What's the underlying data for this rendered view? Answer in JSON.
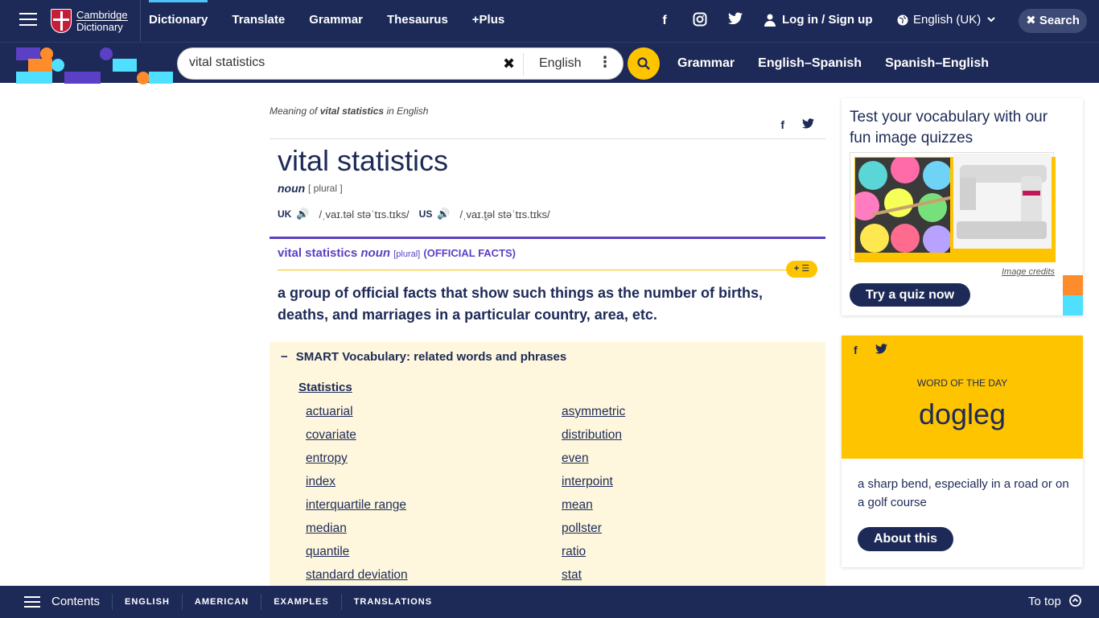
{
  "topnav": {
    "logo_line1": "Cambridge",
    "logo_line2": "Dictionary",
    "links": [
      "Dictionary",
      "Translate",
      "Grammar",
      "Thesaurus",
      "+Plus"
    ],
    "active_link": "Dictionary",
    "social": [
      "facebook-icon",
      "instagram-icon",
      "twitter-icon"
    ],
    "login": "Log in / Sign up",
    "language": "English (UK)",
    "search_label": "Search"
  },
  "subbar": {
    "search_value": "vital statistics",
    "dict_language": "English",
    "links": [
      "Grammar",
      "English–Spanish",
      "Spanish–English"
    ]
  },
  "entry": {
    "meaning_prefix": "Meaning of",
    "meaning_word": "vital statistics",
    "meaning_suffix": "in English",
    "headword": "vital statistics",
    "pos": "noun",
    "grammar": "[ plural ]",
    "uk_label": "UK",
    "uk_ipa": "/ˌvaɪ.təl stəˈtɪs.tɪks/",
    "us_label": "US",
    "us_ipa": "/ˌvaɪ.t̬əl stəˈtɪs.tɪks/",
    "sense_word": "vital statistics",
    "sense_pos": "noun",
    "sense_gram": "[plural]",
    "sense_guide": "(OFFICIAL FACTS)",
    "plus_label": "+ ☰",
    "definition": "a group of official facts that show such things as the number of births, deaths, and marriages in a particular country, area, etc."
  },
  "smart_vocab": {
    "minus": "−",
    "title": "SMART Vocabulary: related words and phrases",
    "topic": "Statistics",
    "col1": [
      "actuarial",
      "covariate",
      "entropy",
      "index",
      "interquartile range",
      "median",
      "quantile",
      "standard deviation"
    ],
    "col2": [
      "asymmetric",
      "distribution",
      "even",
      "interpoint",
      "mean",
      "pollster",
      "ratio",
      "stat"
    ]
  },
  "quiz": {
    "title": "Test your vocabulary with our fun image quizzes",
    "image_credits": "Image credits",
    "button": "Try a quiz now"
  },
  "wotd": {
    "label": "WORD OF THE DAY",
    "word": "dogleg",
    "definition": "a sharp bend, especially in a road or on a golf course",
    "button": "About this"
  },
  "bottombar": {
    "contents": "Contents",
    "links": [
      "ENGLISH",
      "AMERICAN",
      "EXAMPLES",
      "TRANSLATIONS"
    ],
    "to_top": "To top"
  },
  "colors": {
    "navy": "#1d2a57",
    "yellow": "#fec400",
    "purple": "#5b3fc4",
    "cream": "#fef7dd"
  }
}
